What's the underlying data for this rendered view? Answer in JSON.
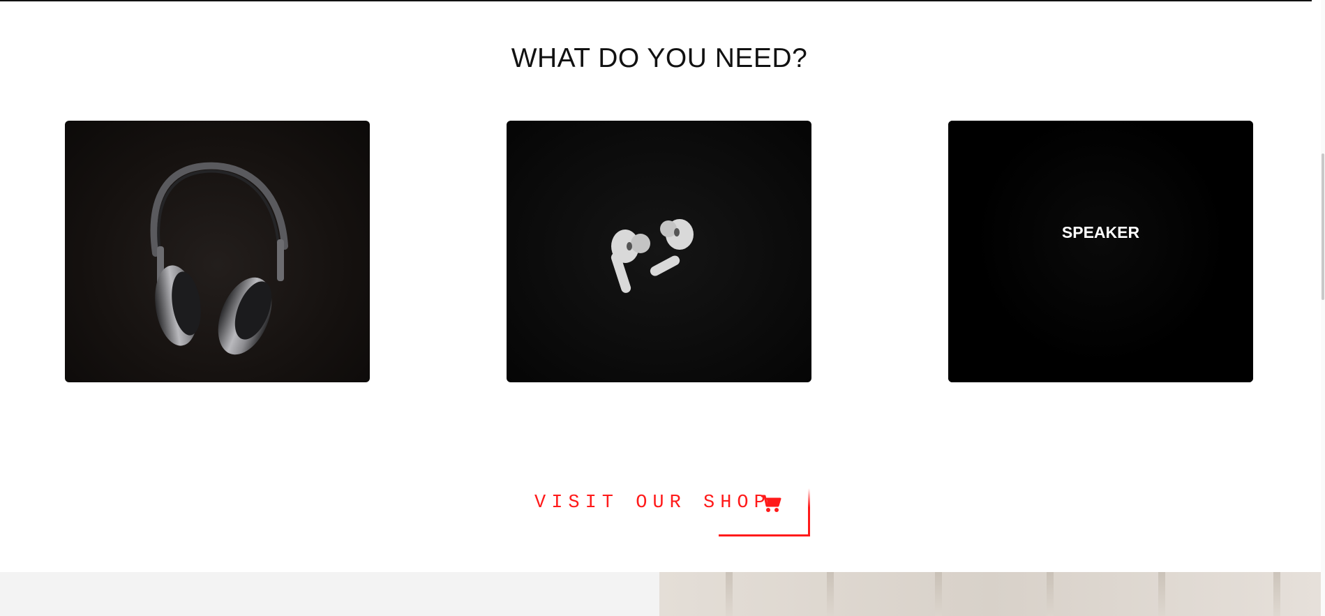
{
  "section": {
    "heading": "WHAT DO YOU NEED?"
  },
  "cards": [
    {
      "label": "",
      "image": "headphones-image"
    },
    {
      "label": "",
      "image": "earbuds-image"
    },
    {
      "label": "SPEAKER",
      "image": "speaker-image"
    }
  ],
  "shop_button": {
    "label": "VISIT OUR SHOP",
    "icon": "cart-icon",
    "color": "#ff1a1a"
  }
}
